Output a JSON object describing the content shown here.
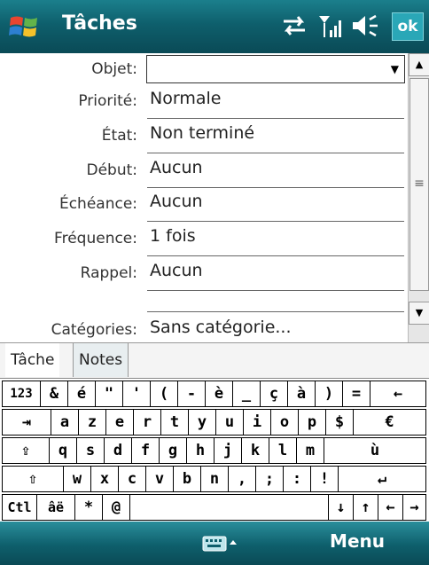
{
  "title_bar": {
    "app_title": "Tâches",
    "ok_label": "ok",
    "icons": [
      "start-windows-icon",
      "sync-icon",
      "signal-icon",
      "volume-icon"
    ]
  },
  "form": {
    "fields": [
      {
        "label": "Objet:",
        "value": ""
      },
      {
        "label": "Priorité:",
        "value": "Normale"
      },
      {
        "label": "État:",
        "value": "Non terminé"
      },
      {
        "label": "Début:",
        "value": "Aucun"
      },
      {
        "label": "Échéance:",
        "value": "Aucun"
      },
      {
        "label": "Fréquence:",
        "value": "1 fois"
      },
      {
        "label": "Rappel:",
        "value": "Aucun"
      },
      {
        "label": "Catégories:",
        "value": "Sans catégorie..."
      }
    ]
  },
  "tabs": [
    {
      "label": "Tâche",
      "active": true
    },
    {
      "label": "Notes",
      "active": false
    }
  ],
  "keyboard": {
    "rows": [
      [
        "123",
        "&",
        "é",
        "\"",
        "'",
        "(",
        "-",
        "è",
        "_",
        "ç",
        "à",
        ")",
        "=",
        "←"
      ],
      [
        "⇥",
        "a",
        "z",
        "e",
        "r",
        "t",
        "y",
        "u",
        "i",
        "o",
        "p",
        "$",
        "€"
      ],
      [
        "⇪",
        "q",
        "s",
        "d",
        "f",
        "g",
        "h",
        "j",
        "k",
        "l",
        "m",
        "ù"
      ],
      [
        "⇧",
        "w",
        "x",
        "c",
        "v",
        "b",
        "n",
        ",",
        ";",
        ":",
        "!",
        "↵"
      ],
      [
        "Ctl",
        "âë",
        "*",
        "@",
        "",
        "↓",
        "↑",
        "←",
        "→"
      ]
    ]
  },
  "bottom_bar": {
    "menu_label": "Menu"
  },
  "colors": {
    "bar_teal": "#0e5f6c",
    "ok_button": "#2aa7b7"
  }
}
